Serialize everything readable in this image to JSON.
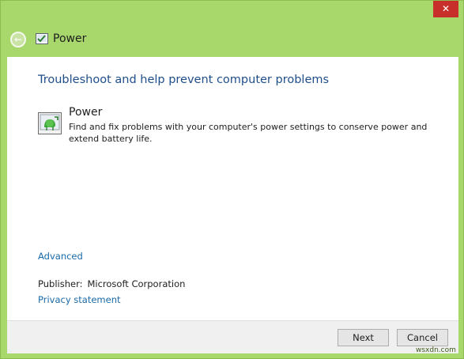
{
  "window": {
    "title": "Power",
    "close_glyph": "✕",
    "back_glyph": "←",
    "accent_color": "#a8d76b"
  },
  "main": {
    "heading": "Troubleshoot and help prevent computer problems",
    "item": {
      "title": "Power",
      "description": "Find and fix problems with your computer's power settings to conserve power and extend battery life.",
      "icon": "power-troubleshooter-icon"
    },
    "advanced_link": "Advanced",
    "publisher_label": "Publisher:",
    "publisher_value": "Microsoft Corporation",
    "privacy_link": "Privacy statement"
  },
  "footer": {
    "next_label": "Next",
    "cancel_label": "Cancel"
  },
  "watermark": "wsxdn.com"
}
